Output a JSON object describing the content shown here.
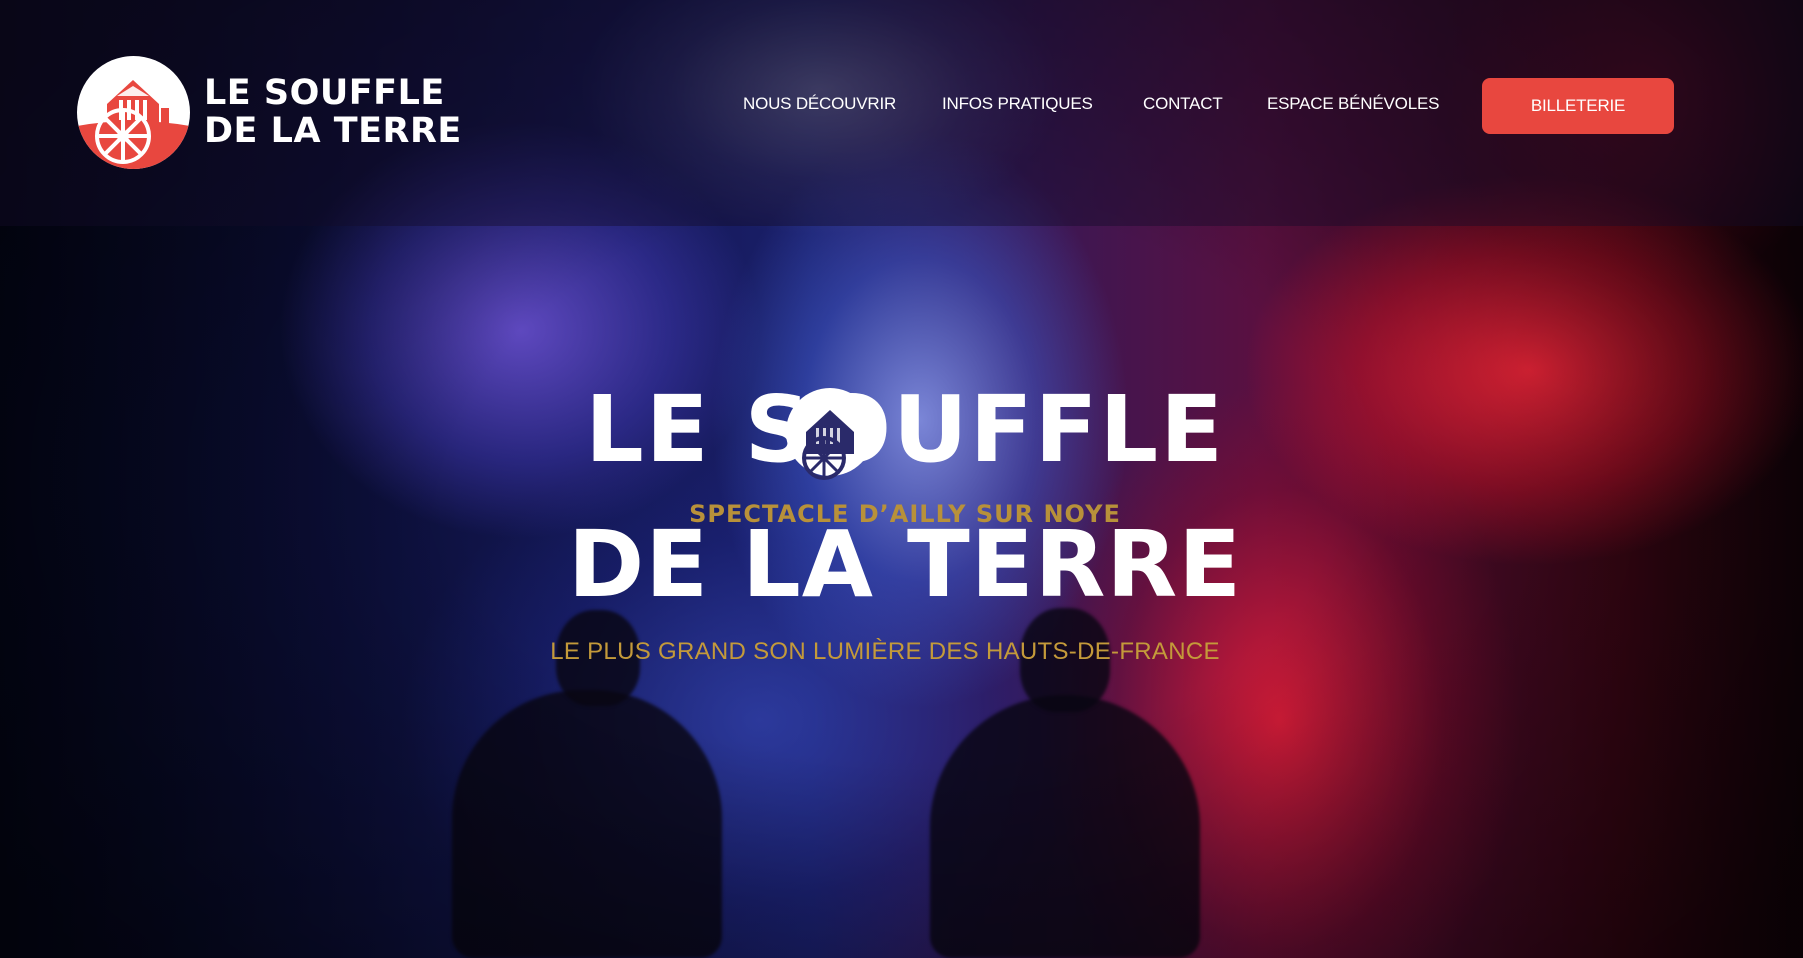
{
  "colors": {
    "accent": "#e8473f",
    "gold": "#c49a3a",
    "text": "#ffffff"
  },
  "logo": {
    "icon": "watermill-icon",
    "line1": "LE SOUFFLE",
    "line2": "DE LA TERRE"
  },
  "nav": {
    "items": [
      {
        "label": "NOUS DÉCOUVRIR"
      },
      {
        "label": "INFOS PRATIQUES"
      },
      {
        "label": "CONTACT"
      },
      {
        "label": "ESPACE BÉNÉVOLES"
      }
    ],
    "cta_label": "BILLETERIE"
  },
  "hero": {
    "title_line1": "LE SOUFFLE",
    "kicker": "SPECTACLE D’AILLY SUR NOYE",
    "title_line2": "DE LA TERRE",
    "tagline": "LE PLUS GRAND SON LUMIÈRE DES HAUTS-DE-FRANCE",
    "emblem_icon": "watermill-icon"
  }
}
